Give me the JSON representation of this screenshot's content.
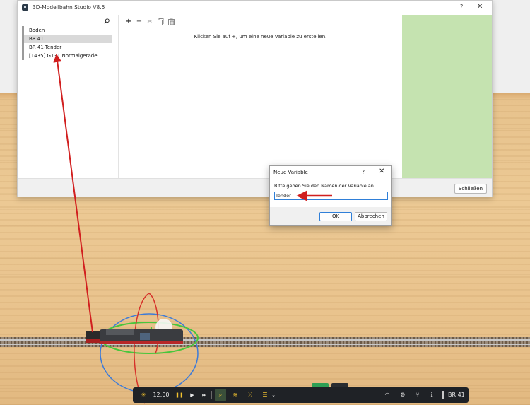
{
  "window": {
    "title": "3D-Modellbahn Studio V8.5",
    "help": "?",
    "close": "✕"
  },
  "left_pane": {
    "search_icon": "search-icon",
    "items": [
      {
        "label": "Boden"
      },
      {
        "label": "BR 41"
      },
      {
        "label": "BR 41-Tender"
      },
      {
        "label": "[1435] G131 Normalgerade"
      }
    ]
  },
  "toolbar": {
    "add": "+",
    "remove": "−",
    "cut": "✂",
    "copy": "⎘",
    "paste": "📋"
  },
  "center": {
    "hint": "Klicken Sie auf +, um eine neue Variable zu erstellen."
  },
  "footer": {
    "close_button": "Schließen"
  },
  "dialog": {
    "title": "Neue Variable",
    "help": "?",
    "close": "✕",
    "prompt": "Bitte geben Sie den Namen der Variable an.",
    "input_value": "Tender",
    "ok": "OK",
    "cancel": "Abbrechen"
  },
  "bottombar": {
    "sun_icon": "☀",
    "time": "12:00",
    "pause": "❚❚",
    "play": "▶",
    "skip": "⏭",
    "search": "⌕",
    "layers": "≋",
    "shuffle": "⤨",
    "list": "☰",
    "dropdown": "⌄",
    "signal": "◠",
    "gear": "⚙",
    "split": "⑂",
    "info": "ℹ",
    "loco": "BR 41"
  },
  "colors": {
    "accent": "#2f7fd8",
    "annotation": "#d11f1f",
    "right_pane": "#c5e3b0",
    "mode_active": "#2ea055"
  }
}
